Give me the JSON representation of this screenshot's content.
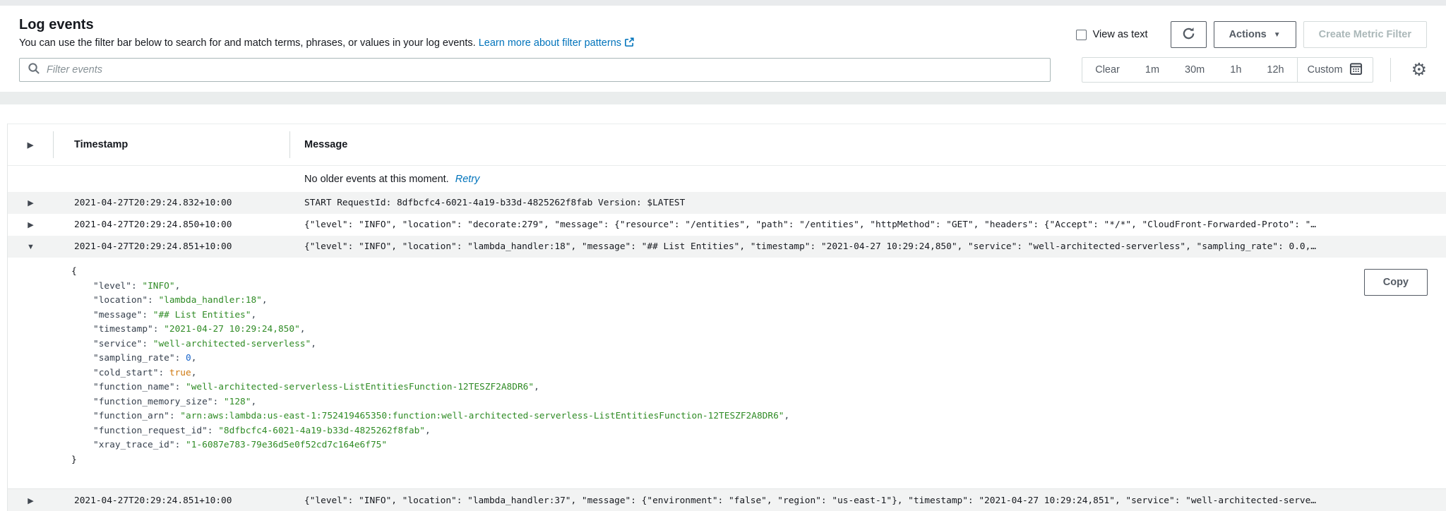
{
  "colors": {
    "link": "#0073bb",
    "json-key": "#37414e",
    "json-string": "#2f8b25",
    "json-number": "#1a66cc",
    "json-boolean": "#cf7911"
  },
  "header": {
    "title": "Log events",
    "description": "You can use the filter bar below to search for and match terms, phrases, or values in your log events.",
    "learn_more_link": "Learn more about filter patterns",
    "view_as_text_label": "View as text",
    "actions_button": "Actions",
    "create_metric_filter_button": "Create Metric Filter"
  },
  "filter": {
    "placeholder": "Filter events",
    "ranges": [
      "Clear",
      "1m",
      "30m",
      "1h",
      "12h"
    ],
    "custom_label": "Custom"
  },
  "table": {
    "columns": {
      "timestamp": "Timestamp",
      "message": "Message"
    },
    "notice": {
      "text": "No older events at this moment.",
      "retry_link": "Retry"
    },
    "rows": [
      {
        "expanded": false,
        "shade": true,
        "border_top": false,
        "timestamp": "2021-04-27T20:29:24.832+10:00",
        "message": "START RequestId: 8dfbcfc4-6021-4a19-b33d-4825262f8fab Version: $LATEST"
      },
      {
        "expanded": false,
        "shade": false,
        "border_top": false,
        "timestamp": "2021-04-27T20:29:24.850+10:00",
        "message": "{\"level\": \"INFO\", \"location\": \"decorate:279\", \"message\": {\"resource\": \"/entities\", \"path\": \"/entities\", \"httpMethod\": \"GET\", \"headers\": {\"Accept\": \"*/*\", \"CloudFront-Forwarded-Proto\": \"…"
      },
      {
        "expanded": true,
        "shade": true,
        "border_top": false,
        "timestamp": "2021-04-27T20:29:24.851+10:00",
        "message": "{\"level\": \"INFO\", \"location\": \"lambda_handler:18\", \"message\": \"## List Entities\", \"timestamp\": \"2021-04-27 10:29:24,850\", \"service\": \"well-architected-serverless\", \"sampling_rate\": 0.0,…"
      },
      {
        "expanded": false,
        "shade": true,
        "border_top": true,
        "timestamp": "2021-04-27T20:29:24.851+10:00",
        "message": "{\"level\": \"INFO\", \"location\": \"lambda_handler:37\", \"message\": {\"environment\": \"false\", \"region\": \"us-east-1\"}, \"timestamp\": \"2021-04-27 10:29:24,851\", \"service\": \"well-architected-serve…"
      }
    ]
  },
  "expanded_detail": {
    "copy_button": "Copy",
    "open_brace": "{",
    "close_brace": "}",
    "entries": [
      {
        "key": "level",
        "type": "string",
        "value": "\"INFO\""
      },
      {
        "key": "location",
        "type": "string",
        "value": "\"lambda_handler:18\""
      },
      {
        "key": "message",
        "type": "string",
        "value": "\"## List Entities\""
      },
      {
        "key": "timestamp",
        "type": "string",
        "value": "\"2021-04-27 10:29:24,850\""
      },
      {
        "key": "service",
        "type": "string",
        "value": "\"well-architected-serverless\""
      },
      {
        "key": "sampling_rate",
        "type": "number",
        "value": "0"
      },
      {
        "key": "cold_start",
        "type": "boolean",
        "value": "true"
      },
      {
        "key": "function_name",
        "type": "string",
        "value": "\"well-architected-serverless-ListEntitiesFunction-12TESZF2A8DR6\""
      },
      {
        "key": "function_memory_size",
        "type": "string",
        "value": "\"128\""
      },
      {
        "key": "function_arn",
        "type": "string",
        "value": "\"arn:aws:lambda:us-east-1:752419465350:function:well-architected-serverless-ListEntitiesFunction-12TESZF2A8DR6\""
      },
      {
        "key": "function_request_id",
        "type": "string",
        "value": "\"8dfbcfc4-6021-4a19-b33d-4825262f8fab\""
      },
      {
        "key": "xray_trace_id",
        "type": "string",
        "value": "\"1-6087e783-79e36d5e0f52cd7c164e6f75\""
      }
    ]
  }
}
